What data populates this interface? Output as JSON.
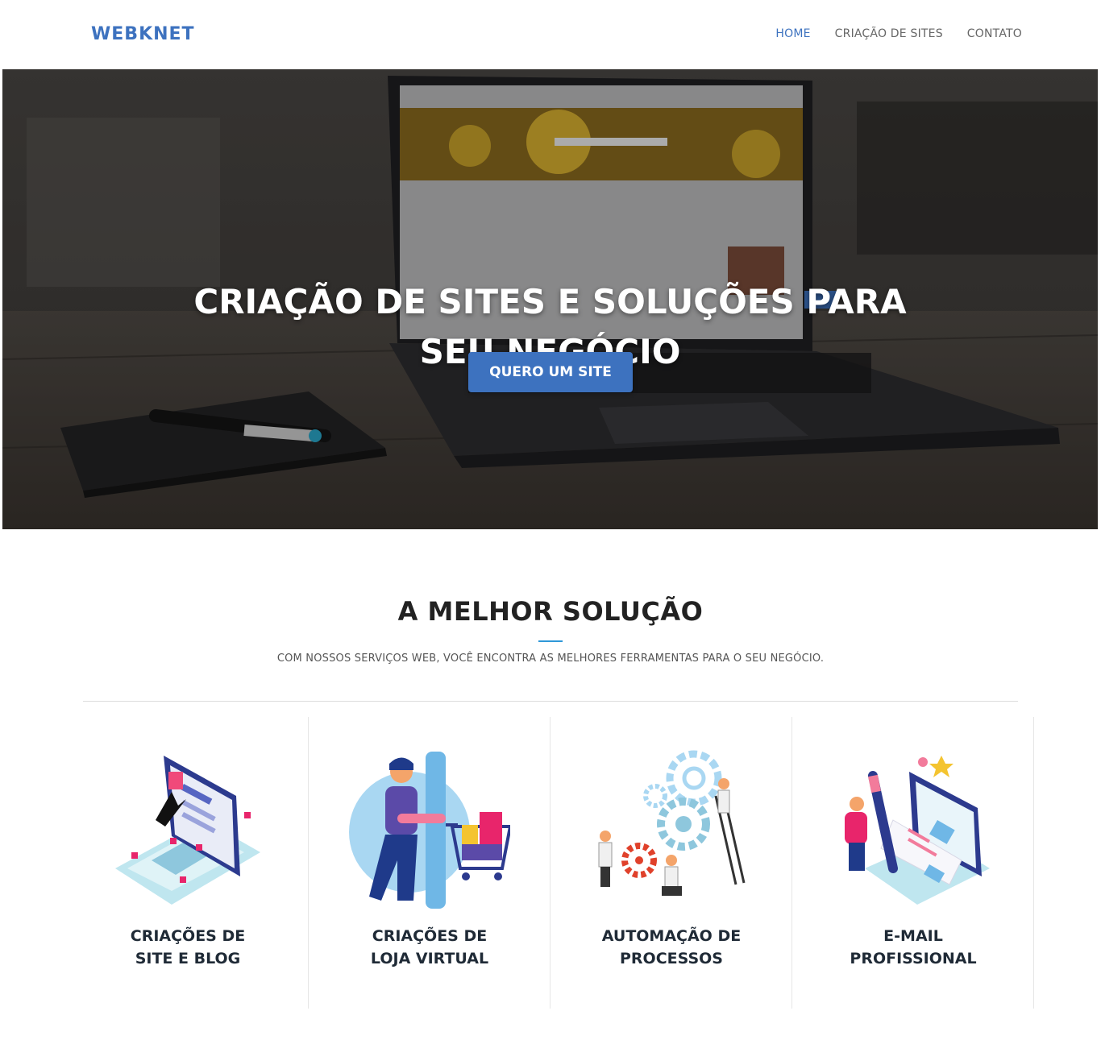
{
  "header": {
    "logo_text": "WEBKNET",
    "nav": [
      {
        "label": "HOME",
        "active": true
      },
      {
        "label": "CRIAÇÃO DE SITES",
        "active": false
      },
      {
        "label": "CONTATO",
        "active": false
      }
    ]
  },
  "hero": {
    "title_line1": "CRIAÇÃO DE SITES E SOLUÇÕES PARA",
    "title_line2": "SEU NEGÓCIO",
    "button_label": "QUERO UM SITE"
  },
  "section": {
    "title": "A MELHOR SOLUÇÃO",
    "subtitle": "COM NOSSOS SERVIÇOS WEB, VOCÊ ENCONTRA AS MELHORES FERRAMENTAS PARA O SEU NEGÓCIO."
  },
  "services": [
    {
      "line1": "CRIAÇÕES DE",
      "line2": "SITE E BLOG",
      "icon": "laptop-blog-illustration"
    },
    {
      "line1": "CRIAÇÕES DE",
      "line2": "LOJA VIRTUAL",
      "icon": "shopping-cart-illustration"
    },
    {
      "line1": "AUTOMAÇÃO DE",
      "line2": "PROCESSOS",
      "icon": "gears-team-illustration"
    },
    {
      "line1": "E-MAIL",
      "line2": "PROFISSIONAL",
      "icon": "email-pencil-illustration"
    }
  ],
  "colors": {
    "brand": "#3d72bf",
    "accent_line": "#2f98d8",
    "heading": "#222222"
  }
}
